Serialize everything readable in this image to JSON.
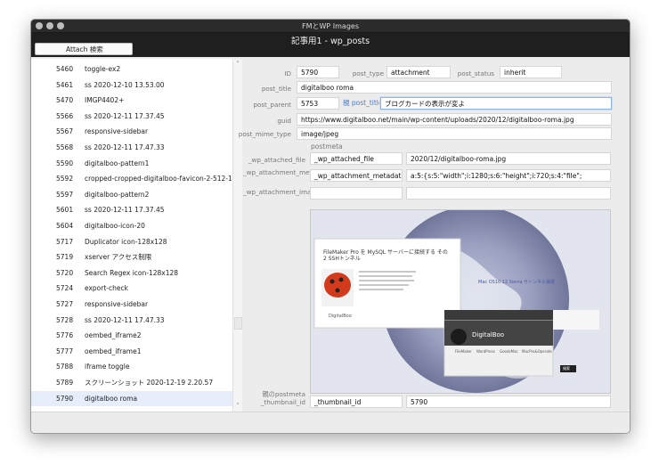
{
  "window": {
    "title": "FMとWP Images",
    "layout_title": "記事用1 - wp_posts"
  },
  "toolbar": {
    "attach_search_label": "Attach 検索"
  },
  "list": {
    "rows": [
      {
        "id": "5460",
        "name": "toggle-ex2"
      },
      {
        "id": "5461",
        "name": "ss 2020-12-10 13.53.00"
      },
      {
        "id": "5470",
        "name": "IMGP4402+"
      },
      {
        "id": "5566",
        "name": "ss 2020-12-11 17.37.45"
      },
      {
        "id": "5567",
        "name": "responsive-sidebar"
      },
      {
        "id": "5568",
        "name": "ss 2020-12-11 17.47.33"
      },
      {
        "id": "5590",
        "name": "digitalboo-pattern1"
      },
      {
        "id": "5592",
        "name": "cropped-cropped-digitalboo-favicon-2-512-1."
      },
      {
        "id": "5597",
        "name": "digitalboo-pattern2"
      },
      {
        "id": "5601",
        "name": "ss 2020-12-11 17.37.45"
      },
      {
        "id": "5604",
        "name": "digitalboo-icon-20"
      },
      {
        "id": "5717",
        "name": "Duplicator icon-128x128"
      },
      {
        "id": "5719",
        "name": "xserver アクセス制限"
      },
      {
        "id": "5720",
        "name": "Search Regex icon-128x128"
      },
      {
        "id": "5724",
        "name": "export-check"
      },
      {
        "id": "5727",
        "name": "responsive-sidebar"
      },
      {
        "id": "5728",
        "name": "ss 2020-12-11 17.47.33"
      },
      {
        "id": "5776",
        "name": "oembed_iframe2"
      },
      {
        "id": "5777",
        "name": "oembed_iframe1"
      },
      {
        "id": "5788",
        "name": "iframe toggle"
      },
      {
        "id": "5789",
        "name": "スクリーンショット 2020-12-19 2.20.57"
      },
      {
        "id": "5790",
        "name": "digitalboo roma"
      }
    ],
    "selected_id": "5790"
  },
  "detail": {
    "id_label": "ID",
    "id_value": "5790",
    "post_type_label": "post_type",
    "post_type_value": "attachment",
    "post_status_label": "post_status",
    "post_status_value": "inherit",
    "post_title_label": "post_title",
    "post_title_value": "digitalboo roma",
    "post_parent_label": "post_parent",
    "post_parent_value": "5753",
    "parent_title_label": "親 post_title",
    "parent_title_value": "ブログカードの表示が変よ",
    "guid_label": "guid",
    "guid_value": "https://www.digitalboo.net/main/wp-content/uploads/2020/12/digitalboo-roma.jpg",
    "mime_label": "post_mime_type",
    "mime_value": "image/jpeg",
    "postmeta_label": "postmeta",
    "meta": [
      {
        "label": "_wp_attached_file",
        "key": "_wp_attached_file",
        "value": "2020/12/digitalboo-roma.jpg"
      },
      {
        "label": "_wp_attachment_metadata",
        "key": "_wp_attachment_metadata",
        "value": "a:5:{s:5:\"width\";i:1280;s:6:\"height\";i:720;s:4:\"file\";"
      },
      {
        "label": "_wp_attachment_image_alt",
        "key": "",
        "value": ""
      }
    ],
    "parent_meta_label": "親のpostmeta _thumbnail_id",
    "thumbnail_key": "_thumbnail_id",
    "thumbnail_value": "5790"
  },
  "preview": {
    "card_title": "FileMaker Pro を MySQL サーバーに接続する その2 SSHトンネル",
    "card_site": "DigitalBoo",
    "right_text": "Mac OS10.12 Sierra サトンネル接続",
    "widget_brand": "DigitalBoo",
    "widget_tab1": "FileMaker",
    "widget_tab2": "WordPress",
    "widget_tab3": "GoodsMac",
    "widget_tab4": "MacPro&Operate",
    "widget_btn": "検索"
  },
  "colors": {
    "accent": "#4a7bd0",
    "header": "#1f1f1f",
    "selected_row": "#e6eefc"
  }
}
